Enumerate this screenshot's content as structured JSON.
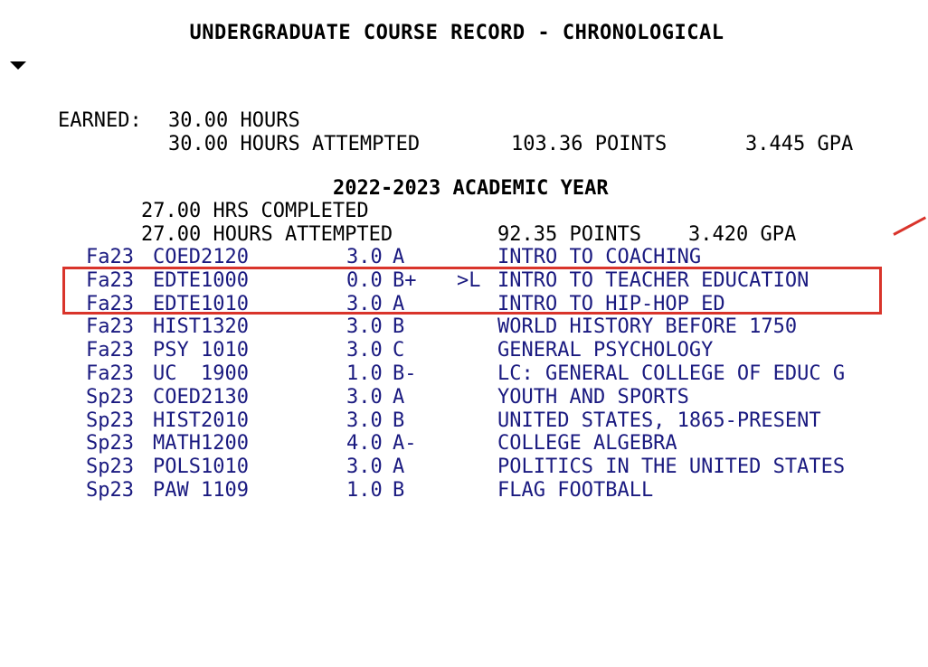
{
  "header": {
    "title": "UNDERGRADUATE COURSE RECORD - CHRONOLOGICAL"
  },
  "summary": {
    "earned_label": "EARNED:",
    "earned_hours": "30.00 HOURS",
    "attempted": "30.00 HOURS ATTEMPTED",
    "points": "103.36 POINTS",
    "gpa": "3.445 GPA"
  },
  "year": {
    "title": "2022-2023 ACADEMIC YEAR",
    "completed": "27.00 HRS COMPLETED",
    "attempted": "27.00 HOURS ATTEMPTED",
    "points": "92.35 POINTS",
    "gpa": "3.420 GPA"
  },
  "courses": [
    {
      "term": "Fa23",
      "code": "COED2120",
      "hours": "3.0",
      "grade": "A",
      "flag": "",
      "title": "INTRO TO COACHING"
    },
    {
      "term": "Fa23",
      "code": "EDTE1000",
      "hours": "0.0",
      "grade": "B+",
      "flag": ">L",
      "title": "INTRO TO TEACHER EDUCATION"
    },
    {
      "term": "Fa23",
      "code": "EDTE1010",
      "hours": "3.0",
      "grade": "A",
      "flag": "",
      "title": "INTRO TO HIP-HOP ED"
    },
    {
      "term": "Fa23",
      "code": "HIST1320",
      "hours": "3.0",
      "grade": "B",
      "flag": "",
      "title": "WORLD HISTORY BEFORE 1750"
    },
    {
      "term": "Fa23",
      "code": "PSY 1010",
      "hours": "3.0",
      "grade": "C",
      "flag": "",
      "title": "GENERAL PSYCHOLOGY"
    },
    {
      "term": "Fa23",
      "code": "UC  1900",
      "hours": "1.0",
      "grade": "B-",
      "flag": "",
      "title": "LC: GENERAL COLLEGE OF EDUC G"
    },
    {
      "term": "Sp23",
      "code": "COED2130",
      "hours": "3.0",
      "grade": "A",
      "flag": "",
      "title": "YOUTH AND SPORTS"
    },
    {
      "term": "Sp23",
      "code": "HIST2010",
      "hours": "3.0",
      "grade": "B",
      "flag": "",
      "title": "UNITED STATES, 1865-PRESENT"
    },
    {
      "term": "Sp23",
      "code": "MATH1200",
      "hours": "4.0",
      "grade": "A-",
      "flag": "",
      "title": "COLLEGE ALGEBRA"
    },
    {
      "term": "Sp23",
      "code": "POLS1010",
      "hours": "3.0",
      "grade": "A",
      "flag": "",
      "title": "POLITICS IN THE UNITED STATES"
    },
    {
      "term": "Sp23",
      "code": "PAW 1109",
      "hours": "1.0",
      "grade": "B",
      "flag": "",
      "title": "FLAG FOOTBALL"
    }
  ],
  "colors": {
    "course_text": "#1a1a80",
    "highlight": "#d9342b"
  }
}
